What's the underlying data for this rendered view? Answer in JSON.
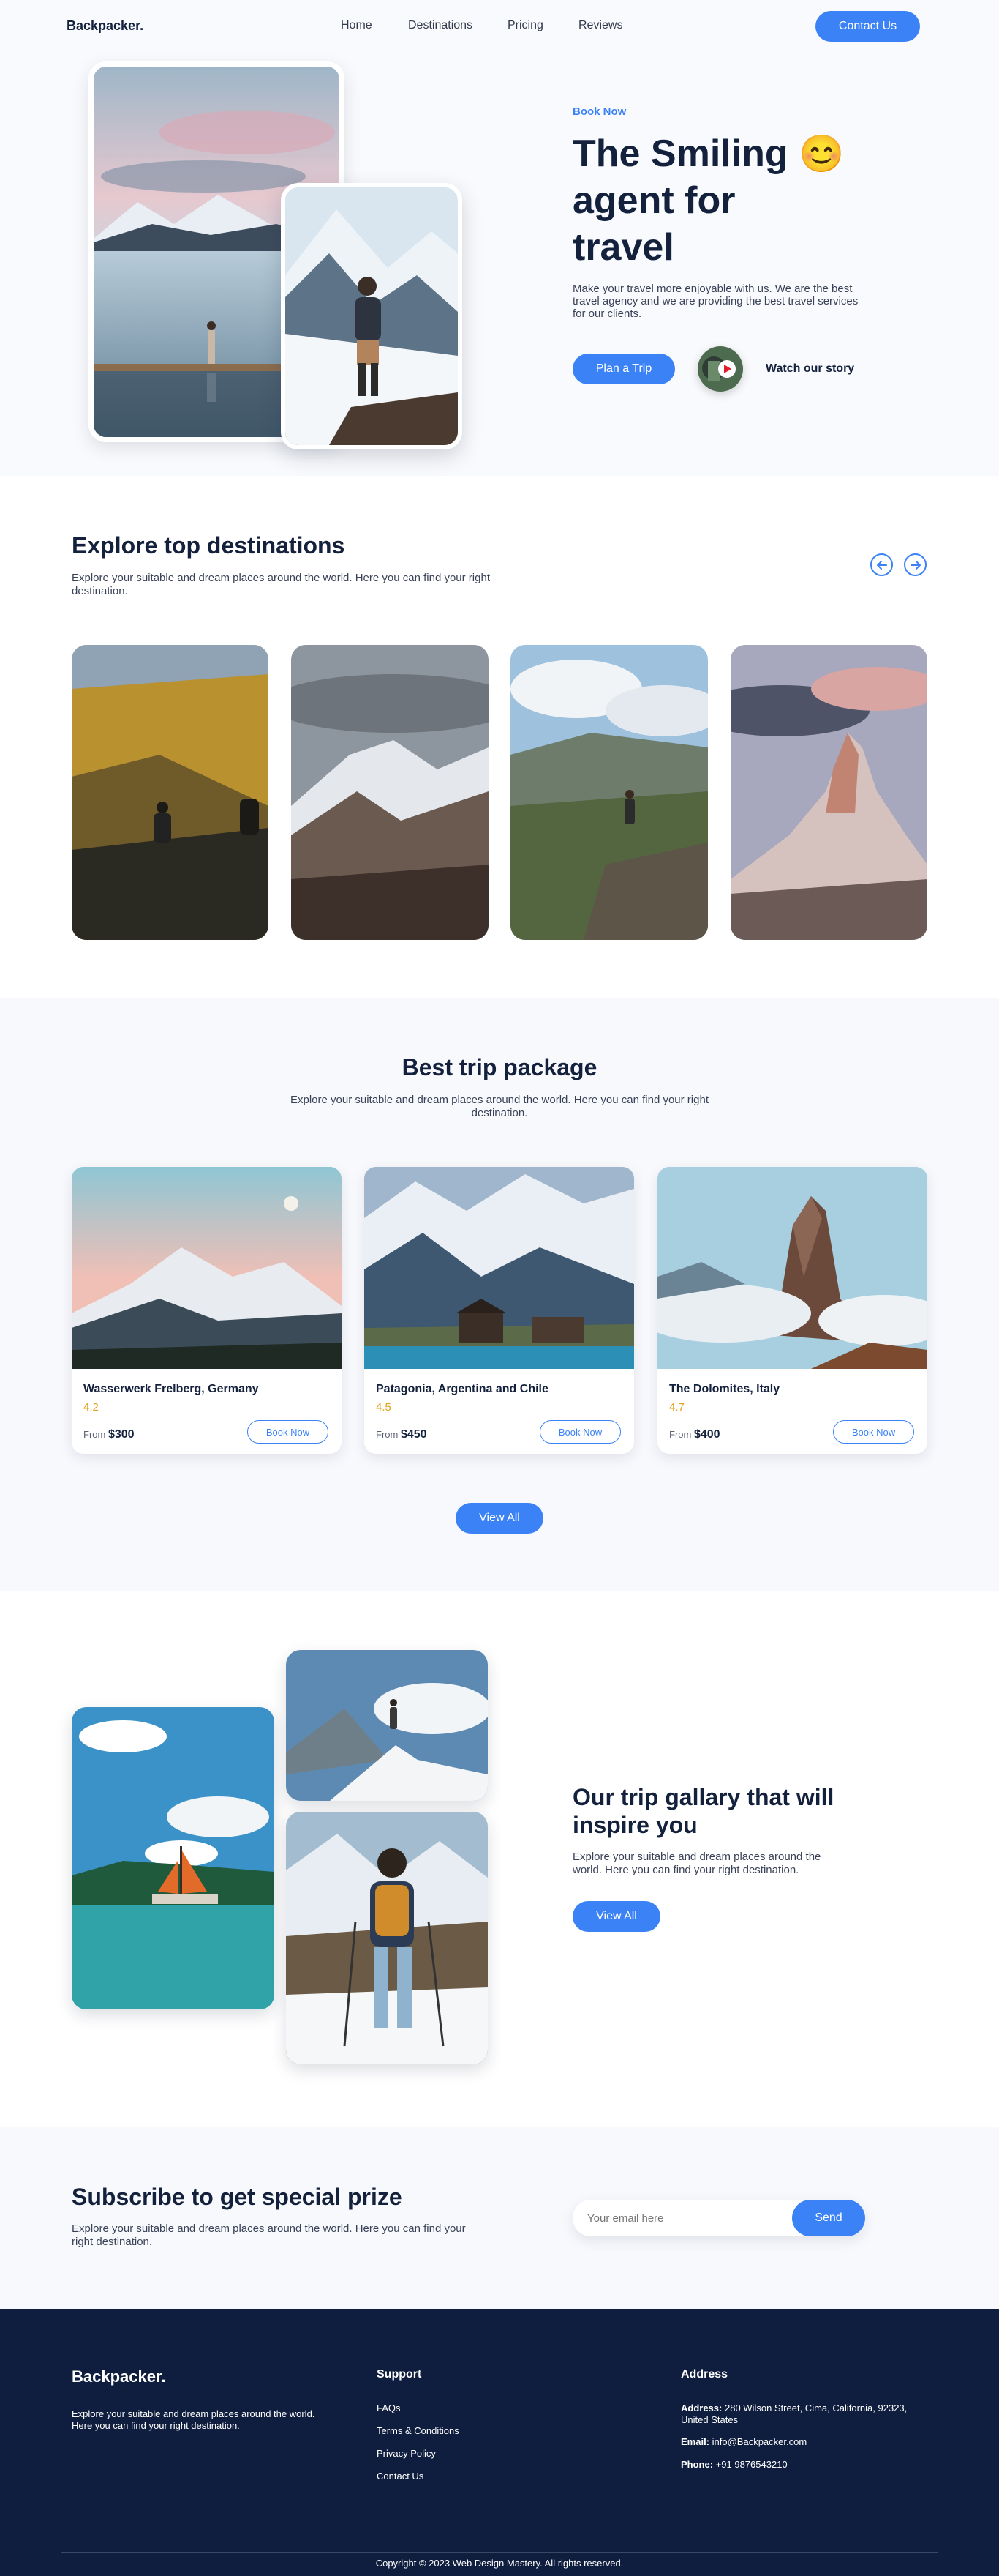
{
  "nav": {
    "logo": "Backpacker.",
    "links": [
      "Home",
      "Destinations",
      "Pricing",
      "Reviews"
    ],
    "cta": "Contact Us"
  },
  "hero": {
    "kicker": "Book Now",
    "title_line1": "The Smiling",
    "emoji": "😊",
    "title_line2": "agent for",
    "title_line3": "travel",
    "description": "Make your travel more enjoyable with us. We are the best travel agency and we are providing the best travel services for our clients.",
    "primary_btn": "Plan a Trip",
    "story_label": "Watch our story"
  },
  "destinations": {
    "title": "Explore top destinations",
    "subtitle": "Explore your suitable and dream places around the world. Here you can find your right destination.",
    "prev_icon": "arrow-left-icon",
    "next_icon": "arrow-right-icon"
  },
  "packages": {
    "title": "Best trip package",
    "subtitle": "Explore your suitable and dream places around the world. Here you can find your right destination.",
    "cards": [
      {
        "name": "Wasserwerk Frelberg, Germany",
        "rating": "4.2",
        "from": "From",
        "price": "$300",
        "btn": "Book Now"
      },
      {
        "name": "Patagonia, Argentina and Chile",
        "rating": "4.5",
        "from": "From",
        "price": "$450",
        "btn": "Book Now"
      },
      {
        "name": "The Dolomites, Italy",
        "rating": "4.7",
        "from": "From",
        "price": "$400",
        "btn": "Book Now"
      }
    ],
    "view_all": "View All"
  },
  "gallery": {
    "title": "Our trip gallary that will inspire you",
    "subtitle": "Explore your suitable and dream places around the world. Here you can find your right destination.",
    "btn": "View All"
  },
  "subscribe": {
    "title": "Subscribe to get special prize",
    "subtitle": "Explore your suitable and dream places around the world. Here you can find your right destination.",
    "placeholder": "Your email here",
    "btn": "Send"
  },
  "footer": {
    "logo": "Backpacker.",
    "about": "Explore your suitable and dream places around the world. Here you can find your right destination.",
    "support_head": "Support",
    "support_links": [
      "FAQs",
      "Terms & Conditions",
      "Privacy Policy",
      "Contact Us"
    ],
    "address_head": "Address",
    "address_label": "Address:",
    "address_value": "280 Wilson Street, Cima, California, 92323, United States",
    "email_label": "Email:",
    "email_value": "info@Backpacker.com",
    "phone_label": "Phone:",
    "phone_value": "+91 9876543210",
    "copyright": "Copyright © 2023 Web Design Mastery. All rights reserved."
  },
  "colors": {
    "accent": "#3b82f6",
    "navy": "#14213d",
    "footer_bg": "#0f1d3e",
    "rating": "#e0a31b"
  }
}
